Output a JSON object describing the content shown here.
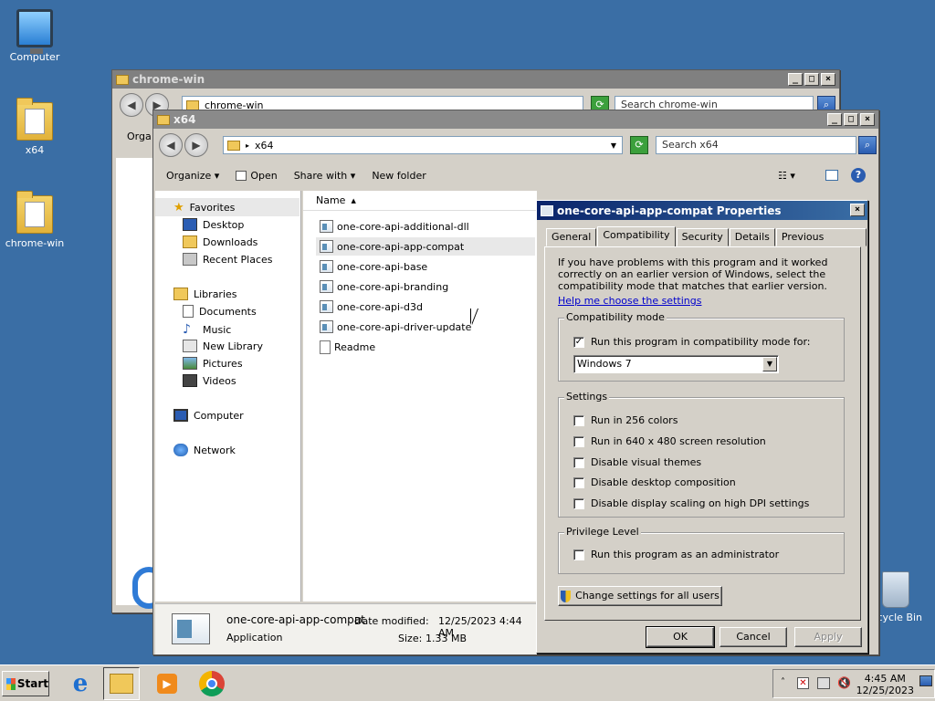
{
  "desktop": {
    "icons": [
      {
        "label": "Computer"
      },
      {
        "label": "x64"
      },
      {
        "label": "chrome-win"
      },
      {
        "label": "cycle Bin"
      }
    ]
  },
  "back_window": {
    "title": "chrome-win",
    "address": "chrome-win",
    "search_placeholder": "Search chrome-win",
    "organize_partial": "Orga"
  },
  "explorer": {
    "title": "x64",
    "address": "x64",
    "search_placeholder": "Search x64",
    "toolbar": {
      "organize": "Organize",
      "open": "Open",
      "share_with": "Share with",
      "new_folder": "New folder"
    },
    "nav": {
      "favorites": "Favorites",
      "desktop": "Desktop",
      "downloads": "Downloads",
      "recent_places": "Recent Places",
      "libraries": "Libraries",
      "documents": "Documents",
      "music": "Music",
      "new_library": "New Library",
      "pictures": "Pictures",
      "videos": "Videos",
      "computer": "Computer",
      "network": "Network"
    },
    "columns": {
      "name": "Name"
    },
    "files": [
      {
        "name": "one-core-api-additional-dll",
        "type": "app"
      },
      {
        "name": "one-core-api-app-compat",
        "type": "app",
        "selected": true
      },
      {
        "name": "one-core-api-base",
        "type": "app"
      },
      {
        "name": "one-core-api-branding",
        "type": "app"
      },
      {
        "name": "one-core-api-d3d",
        "type": "app"
      },
      {
        "name": "one-core-api-driver-update",
        "type": "app"
      },
      {
        "name": "Readme",
        "type": "text"
      }
    ],
    "details": {
      "name": "one-core-api-app-compat",
      "kind": "Application",
      "date_label": "Date modified:",
      "date_value": "12/25/2023 4:44 AM",
      "size_label": "Size:",
      "size_value": "1.33 MB"
    }
  },
  "dialog": {
    "title": "one-core-api-app-compat Properties",
    "tabs": [
      "General",
      "Compatibility",
      "Security",
      "Details",
      "Previous Versions"
    ],
    "active_tab": "Compatibility",
    "intro": "If you have problems with this program and it worked correctly on an earlier version of Windows, select the compatibility mode that matches that earlier version.",
    "help_link": "Help me choose the settings",
    "compat_group": "Compatibility mode",
    "compat_check": "Run this program in compatibility mode for:",
    "compat_checked": true,
    "compat_select": "Windows 7",
    "settings_group": "Settings",
    "settings": [
      {
        "label": "Run in 256 colors",
        "checked": false
      },
      {
        "label": "Run in 640 x 480 screen resolution",
        "checked": false
      },
      {
        "label": "Disable visual themes",
        "checked": false
      },
      {
        "label": "Disable desktop composition",
        "checked": false
      },
      {
        "label": "Disable display scaling on high DPI settings",
        "checked": false
      }
    ],
    "privilege_group": "Privilege Level",
    "privilege_check": "Run this program as an administrator",
    "privilege_checked": false,
    "change_all": "Change settings for all users",
    "ok": "OK",
    "cancel": "Cancel",
    "apply": "Apply"
  },
  "taskbar": {
    "start": "Start",
    "clock_time": "4:45 AM",
    "clock_date": "12/25/2023"
  },
  "colors": {
    "desktop": "#3a6ea5",
    "active_title": "#0a246a",
    "inactive_title": "#808080",
    "link": "#0000cc"
  }
}
